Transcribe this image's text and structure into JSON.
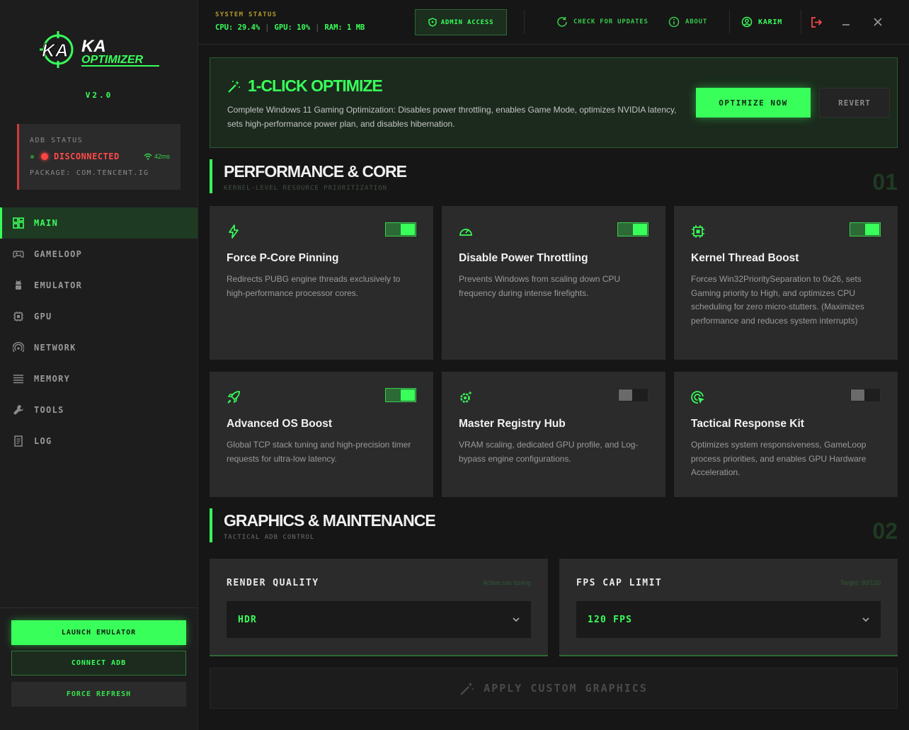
{
  "sidebar": {
    "logo_text": "KA OPTIMIZER",
    "version": "V2.0",
    "adb": {
      "title": "ADB STATUS",
      "state": "DISCONNECTED",
      "ping": "42ms",
      "package": "PACKAGE: COM.TENCENT.IG"
    },
    "nav": [
      {
        "label": "MAIN",
        "icon": "dashboard-icon",
        "active": true
      },
      {
        "label": "GAMELOOP",
        "icon": "gamepad-icon"
      },
      {
        "label": "EMULATOR",
        "icon": "android-icon"
      },
      {
        "label": "GPU",
        "icon": "chip-icon"
      },
      {
        "label": "NETWORK",
        "icon": "signal-icon"
      },
      {
        "label": "MEMORY",
        "icon": "memory-icon"
      },
      {
        "label": "TOOLS",
        "icon": "wrench-icon"
      },
      {
        "label": "LOG",
        "icon": "log-icon"
      }
    ],
    "buttons": {
      "launch": "LAUNCH EMULATOR",
      "connect": "CONNECT ADB",
      "refresh": "FORCE REFRESH"
    }
  },
  "topbar": {
    "system_label": "SYSTEM STATUS",
    "cpu": "CPU: 29.4%",
    "gpu": "GPU: 10%",
    "ram": "RAM: 1 MB",
    "admin": "ADMIN ACCESS",
    "updates": "CHECK FOR UPDATES",
    "about": "ABOUT",
    "user": "KARIM"
  },
  "hero": {
    "title": "1-CLICK OPTIMIZE",
    "description": "Complete Windows 11 Gaming Optimization: Disables power throttling, enables Game Mode, optimizes NVIDIA latency, sets high-performance power plan, and disables hibernation.",
    "optimize": "OPTIMIZE NOW",
    "revert": "REVERT"
  },
  "performance": {
    "title": "PERFORMANCE & CORE",
    "subtitle": "KERNEL-LEVEL RESOURCE PRIORITIZATION",
    "number": "01",
    "cards": [
      {
        "title": "Force P-Core Pinning",
        "desc": "Redirects PUBG engine threads exclusively to high-performance processor cores.",
        "enabled": true,
        "icon": "bolt-icon"
      },
      {
        "title": "Disable Power Throttling",
        "desc": "Prevents Windows from scaling down CPU frequency during intense firefights.",
        "enabled": true,
        "icon": "gauge-icon"
      },
      {
        "title": "Kernel Thread Boost",
        "desc": "Forces Win32PrioritySeparation to 0x26, sets Gaming priority to High, and optimizes CPU scheduling for zero micro-stutters. (Maximizes performance and reduces system interrupts)",
        "enabled": true,
        "icon": "cpu-icon"
      },
      {
        "title": "Advanced OS Boost",
        "desc": "Global TCP stack tuning and high-precision timer requests for ultra-low latency.",
        "enabled": true,
        "icon": "rocket-icon"
      },
      {
        "title": "Master Registry Hub",
        "desc": "VRAM scaling, dedicated GPU profile, and Log-bypass engine configurations.",
        "enabled": false,
        "icon": "gear-sparkle-icon"
      },
      {
        "title": "Tactical Response Kit",
        "desc": "Optimizes system responsiveness, GameLoop process priorities, and enables GPU Hardware Acceleration.",
        "enabled": false,
        "icon": "cursor-target-icon"
      }
    ]
  },
  "graphics": {
    "title": "GRAPHICS & MAINTENANCE",
    "subtitle": "TACTICAL ADB CONTROL",
    "number": "02",
    "render": {
      "label": "RENDER QUALITY",
      "hint": "Active.sav tuning",
      "value": "HDR"
    },
    "fps": {
      "label": "FPS CAP LIMIT",
      "hint": "Target: 90/120",
      "value": "120 FPS"
    },
    "apply": "APPLY CUSTOM GRAPHICS"
  },
  "colors": {
    "accent": "#39ff5a",
    "danger": "#ff4444",
    "bg": "#161616",
    "card": "#2b2b2b"
  }
}
